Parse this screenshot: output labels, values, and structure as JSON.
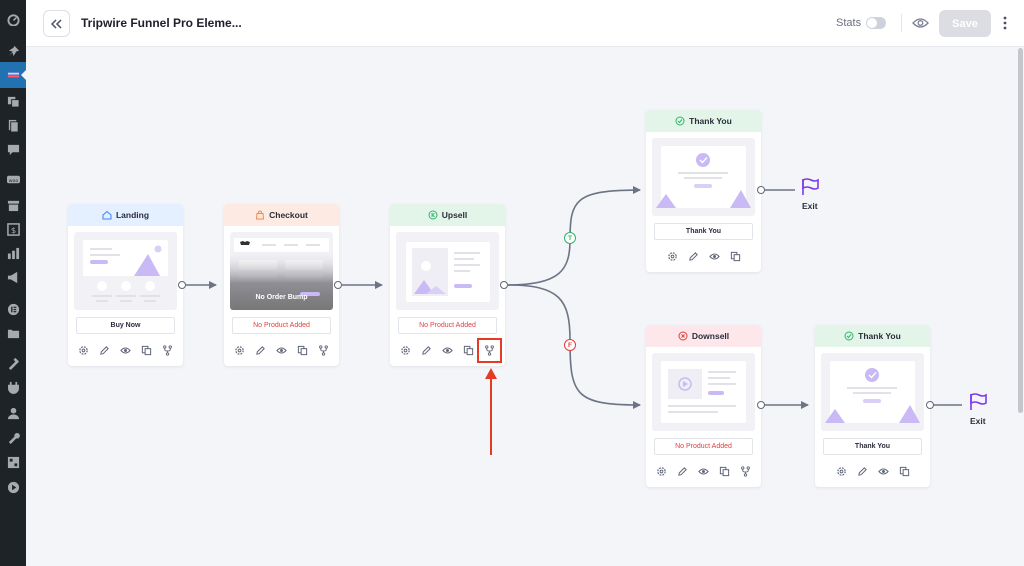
{
  "header": {
    "title": "Tripwire Funnel Pro Eleme...",
    "stats_label": "Stats",
    "save_label": "Save"
  },
  "colors": {
    "accent": "#7c3aed",
    "danger": "#e53e3e",
    "landing_head": "#e4efff",
    "checkout_head": "#fdebe3",
    "upsell_head": "#e2f5e8",
    "thankyou_head": "#e2f5e8",
    "downsell_head": "#fde7ea"
  },
  "steps": {
    "landing": {
      "title": "Landing",
      "button": "Buy Now",
      "icon": "home-icon"
    },
    "checkout": {
      "title": "Checkout",
      "button": "No Product Added",
      "icon": "bag-icon",
      "overlay": "No Order Bump"
    },
    "upsell": {
      "title": "Upsell",
      "button": "No Product Added",
      "icon": "upsell-circle-icon"
    },
    "thankyou1": {
      "title": "Thank You",
      "button": "Thank You",
      "icon": "check-circle-icon"
    },
    "downsell": {
      "title": "Downsell",
      "button": "No Product Added",
      "icon": "downsell-circle-icon"
    },
    "thankyou2": {
      "title": "Thank You",
      "button": "Thank You",
      "icon": "check-circle-icon"
    }
  },
  "branches": {
    "true_label": "T",
    "false_label": "F"
  },
  "exit": {
    "label": "Exit"
  }
}
